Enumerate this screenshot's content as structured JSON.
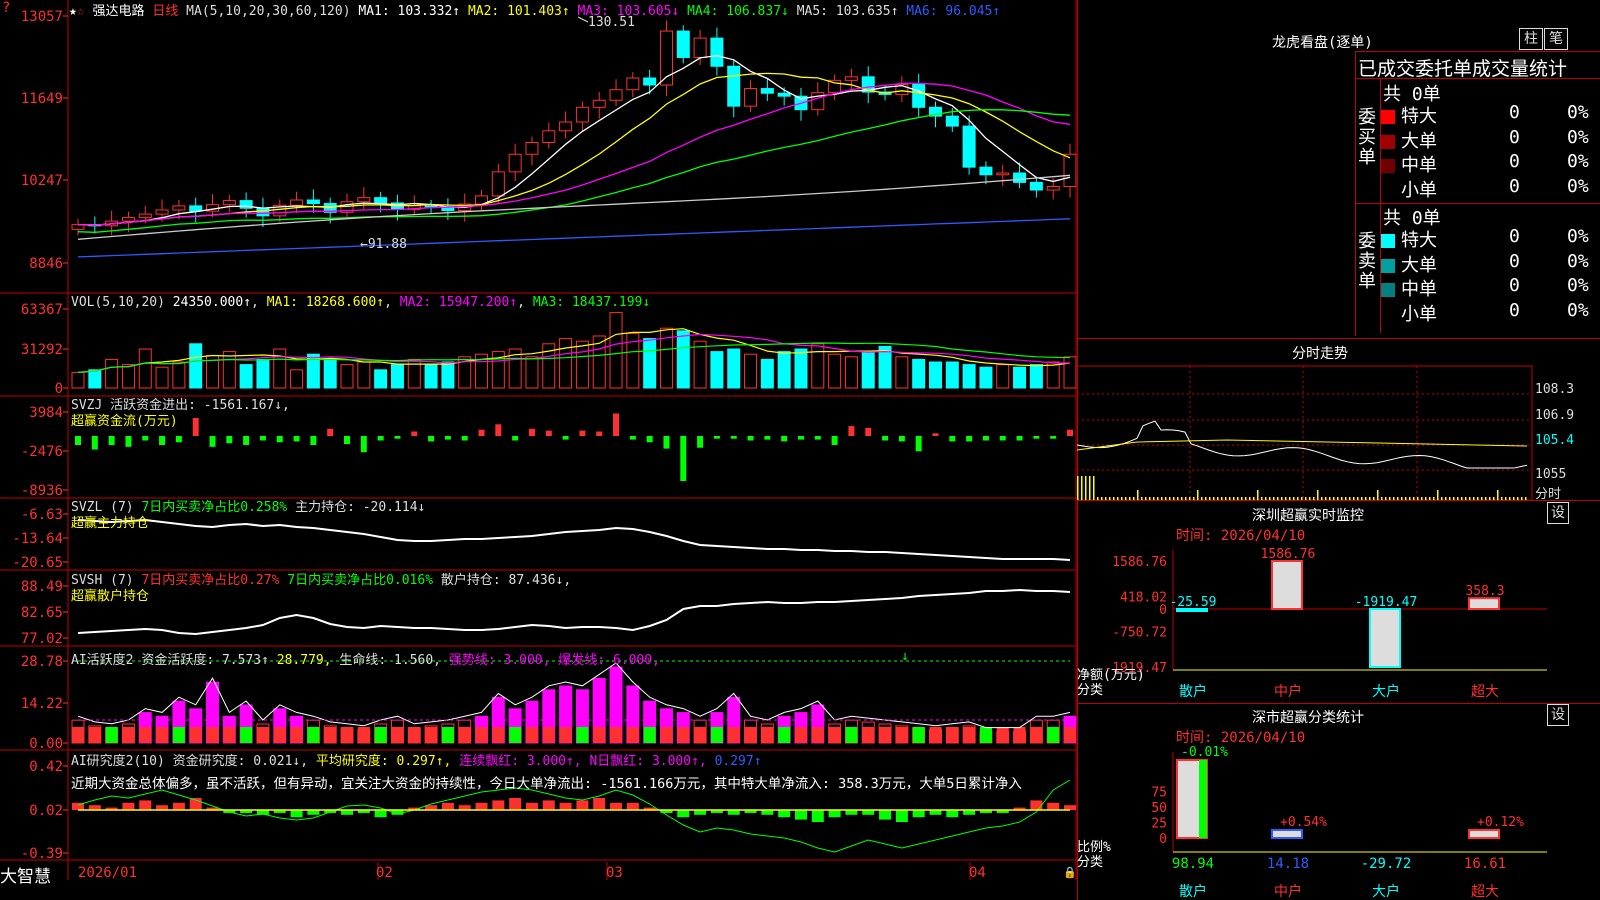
{
  "stock": {
    "name": "强达电路",
    "period": "日线",
    "ma_spec": "MA(5,10,20,30,60,120)"
  },
  "main_legend": [
    {
      "label": "MA1: 103.332↑",
      "color": "#ffffff"
    },
    {
      "label": "MA2: 101.403↑",
      "color": "#ffff00"
    },
    {
      "label": "MA3: 103.605↓",
      "color": "#ff00ff"
    },
    {
      "label": "MA4: 106.837↓",
      "color": "#00ff00"
    },
    {
      "label": "MA5: 103.635↑",
      "color": "#dddddd"
    },
    {
      "label": "MA6: 96.045↑",
      "color": "#2b5cff"
    }
  ],
  "main_yticks": [
    "13057",
    "11649",
    "10247",
    "8846"
  ],
  "main_annotations": {
    "high": "130.51",
    "low": "91.88"
  },
  "vol": {
    "spec": "VOL(5,10,20)",
    "value": "24350.000↑",
    "ma1": "MA1: 18268.600↑",
    "ma2": "MA2: 15947.200↑",
    "ma3": "MA3: 18437.199↓",
    "yticks": [
      "63367",
      "31292",
      "0"
    ]
  },
  "svzj": {
    "line1": "SVZJ  活跃资金进出: -1561.167↓,",
    "line2": "超赢资金流(万元)",
    "yticks": [
      "3984",
      "-2476",
      "-8936"
    ]
  },
  "svzl": {
    "spec": "SVZL (7)",
    "a": "7日内买卖净占比0.258%",
    "b": "主力持仓: -20.114↓",
    "line2": "超赢主力持仓",
    "yticks": [
      "-6.63",
      "-13.64",
      "-20.65"
    ]
  },
  "svsh": {
    "spec": "SVSH (7)",
    "a": "7日内买卖净占比0.27%",
    "b": "7日内买卖净占比0.016%",
    "c": "散户持仓: 87.436↓,",
    "line2": "超赢散户持仓",
    "yticks": [
      "88.49",
      "82.65",
      "77.02"
    ]
  },
  "ai1": {
    "spec": "AI活跃度2",
    "a": "资金活跃度: 7.573↑",
    "b": "28.779,",
    "c": "生命线: 1.560,",
    "d": "强势线: 3.000,",
    "e": "爆发线: 6.000,",
    "yticks": [
      "28.78",
      "14.22",
      "0.00"
    ]
  },
  "ai2": {
    "spec": "AI研究度2(10)",
    "a": "资金研究度: 0.021↓,",
    "b": "平均研究度: 0.297↑,",
    "c": "连续飘红: 3.000↑,",
    "d": "N日飘红: 3.000↑,",
    "e": "0.297↑",
    "commentary": "近期大资金总体偏多，虽不活跃，但有异动，宜关注大资金的持续性，今日大单净流出: -1561.166万元，其中特大单净流入: 358.3万元，大单5日累计净入",
    "yticks": [
      "0.42",
      "0.02",
      "-0.39"
    ]
  },
  "xaxis": {
    "labels": [
      "2026/01",
      "02",
      "03",
      "04"
    ],
    "brand": "大智慧"
  },
  "dragon": {
    "title": "龙虎看盘(逐单)",
    "btn1": "柱",
    "btn2": "笔",
    "subtitle": "已成交委托单成交量统计",
    "buy_side": "委买单",
    "sell_side": "委卖单",
    "buy_total": "共 0单",
    "sell_total": "共 0单",
    "buy_rows": [
      {
        "label": "特大",
        "color": "#ff0000",
        "n": "0",
        "p": "0%"
      },
      {
        "label": "大单",
        "color": "#a00000",
        "n": "0",
        "p": "0%"
      },
      {
        "label": "中单",
        "color": "#700000",
        "n": "0",
        "p": "0%"
      },
      {
        "label": "小单",
        "color": "",
        "n": "0",
        "p": "0%"
      }
    ],
    "sell_rows": [
      {
        "label": "特大",
        "color": "#00ffff",
        "n": "0",
        "p": "0%"
      },
      {
        "label": "大单",
        "color": "#00a0a0",
        "n": "0",
        "p": "0%"
      },
      {
        "label": "中单",
        "color": "#008080",
        "n": "0",
        "p": "0%"
      },
      {
        "label": "小单",
        "color": "",
        "n": "0",
        "p": "0%"
      }
    ]
  },
  "intraday": {
    "title": "分时走势",
    "prices": [
      "108.3",
      "106.9",
      "105.4",
      "1055"
    ],
    "footer": "分时"
  },
  "sz_monitor": {
    "title": "深圳超赢实时监控",
    "btn": "设",
    "time": "时间: 2026/04/10",
    "yticks": [
      "1586.76",
      "418.02",
      "0",
      "-750.72",
      "-1919.47"
    ],
    "ylabel1": "净额(万元)",
    "ylabel2": "分类",
    "chart_data": {
      "type": "bar",
      "categories": [
        "散户",
        "中户",
        "大户",
        "超大"
      ],
      "values": [
        -25.59,
        1586.76,
        -1919.47,
        358.3
      ],
      "value_labels": [
        "-25.59",
        "1586.76",
        "-1919.47",
        "358.3"
      ],
      "ylim": [
        -1919.47,
        1586.76
      ]
    }
  },
  "sz_class": {
    "title": "深市超赢分类统计",
    "btn": "设",
    "time": "时间: 2026/04/10",
    "yticks": [
      "75",
      "50",
      "25",
      "0"
    ],
    "ylabel1": "比例%",
    "ylabel2": "分类",
    "chart_data": {
      "type": "bar",
      "categories": [
        "散户",
        "中户",
        "大户",
        "超大"
      ],
      "top_labels": [
        "-0.01%",
        "+0.54%",
        "",
        "+0.12%"
      ],
      "values": [
        98.94,
        14.18,
        -29.72,
        16.61
      ],
      "value_labels": [
        "98.94",
        "14.18",
        "-29.72",
        "16.61"
      ]
    }
  },
  "colors": {
    "up": "#ff3030",
    "down": "#00ffff",
    "grid": "#c00000",
    "green": "#00ff00",
    "magenta": "#ff00ff"
  }
}
